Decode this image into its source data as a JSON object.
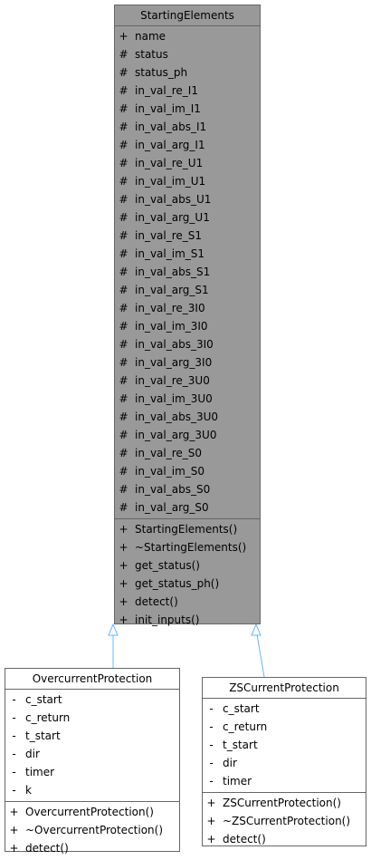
{
  "base": {
    "title": "StartingElements",
    "attributes": [
      {
        "vis": "+",
        "name": "name"
      },
      {
        "vis": "#",
        "name": "status"
      },
      {
        "vis": "#",
        "name": "status_ph"
      },
      {
        "vis": "#",
        "name": "in_val_re_I1"
      },
      {
        "vis": "#",
        "name": "in_val_im_I1"
      },
      {
        "vis": "#",
        "name": "in_val_abs_I1"
      },
      {
        "vis": "#",
        "name": "in_val_arg_I1"
      },
      {
        "vis": "#",
        "name": "in_val_re_U1"
      },
      {
        "vis": "#",
        "name": "in_val_im_U1"
      },
      {
        "vis": "#",
        "name": "in_val_abs_U1"
      },
      {
        "vis": "#",
        "name": "in_val_arg_U1"
      },
      {
        "vis": "#",
        "name": "in_val_re_S1"
      },
      {
        "vis": "#",
        "name": "in_val_im_S1"
      },
      {
        "vis": "#",
        "name": "in_val_abs_S1"
      },
      {
        "vis": "#",
        "name": "in_val_arg_S1"
      },
      {
        "vis": "#",
        "name": "in_val_re_3I0"
      },
      {
        "vis": "#",
        "name": "in_val_im_3I0"
      },
      {
        "vis": "#",
        "name": "in_val_abs_3I0"
      },
      {
        "vis": "#",
        "name": "in_val_arg_3I0"
      },
      {
        "vis": "#",
        "name": "in_val_re_3U0"
      },
      {
        "vis": "#",
        "name": "in_val_im_3U0"
      },
      {
        "vis": "#",
        "name": "in_val_abs_3U0"
      },
      {
        "vis": "#",
        "name": "in_val_arg_3U0"
      },
      {
        "vis": "#",
        "name": "in_val_re_S0"
      },
      {
        "vis": "#",
        "name": "in_val_im_S0"
      },
      {
        "vis": "#",
        "name": "in_val_abs_S0"
      },
      {
        "vis": "#",
        "name": "in_val_arg_S0"
      }
    ],
    "methods": [
      {
        "vis": "+",
        "name": "StartingElements()"
      },
      {
        "vis": "+",
        "name": "~StartingElements()"
      },
      {
        "vis": "+",
        "name": "get_status()"
      },
      {
        "vis": "+",
        "name": "get_status_ph()"
      },
      {
        "vis": "+",
        "name": "detect()"
      },
      {
        "vis": "+",
        "name": "init_inputs()"
      }
    ]
  },
  "overcurrent": {
    "title": "OvercurrentProtection",
    "attributes": [
      {
        "vis": "-",
        "name": "c_start"
      },
      {
        "vis": "-",
        "name": "c_return"
      },
      {
        "vis": "-",
        "name": "t_start"
      },
      {
        "vis": "-",
        "name": "dir"
      },
      {
        "vis": "-",
        "name": "timer"
      },
      {
        "vis": "-",
        "name": "k"
      }
    ],
    "methods": [
      {
        "vis": "+",
        "name": "OvercurrentProtection()"
      },
      {
        "vis": "+",
        "name": "~OvercurrentProtection()"
      },
      {
        "vis": "+",
        "name": "detect()"
      }
    ]
  },
  "zscurrent": {
    "title": "ZSCurrentProtection",
    "attributes": [
      {
        "vis": "-",
        "name": "c_start"
      },
      {
        "vis": "-",
        "name": "c_return"
      },
      {
        "vis": "-",
        "name": "t_start"
      },
      {
        "vis": "-",
        "name": "dir"
      },
      {
        "vis": "-",
        "name": "timer"
      }
    ],
    "methods": [
      {
        "vis": "+",
        "name": "ZSCurrentProtection()"
      },
      {
        "vis": "+",
        "name": "~ZSCurrentProtection()"
      },
      {
        "vis": "+",
        "name": "detect()"
      }
    ]
  },
  "colors": {
    "base_fill": "#999999",
    "border": "#666666",
    "inheritance_arrow": "#63B8FF"
  }
}
